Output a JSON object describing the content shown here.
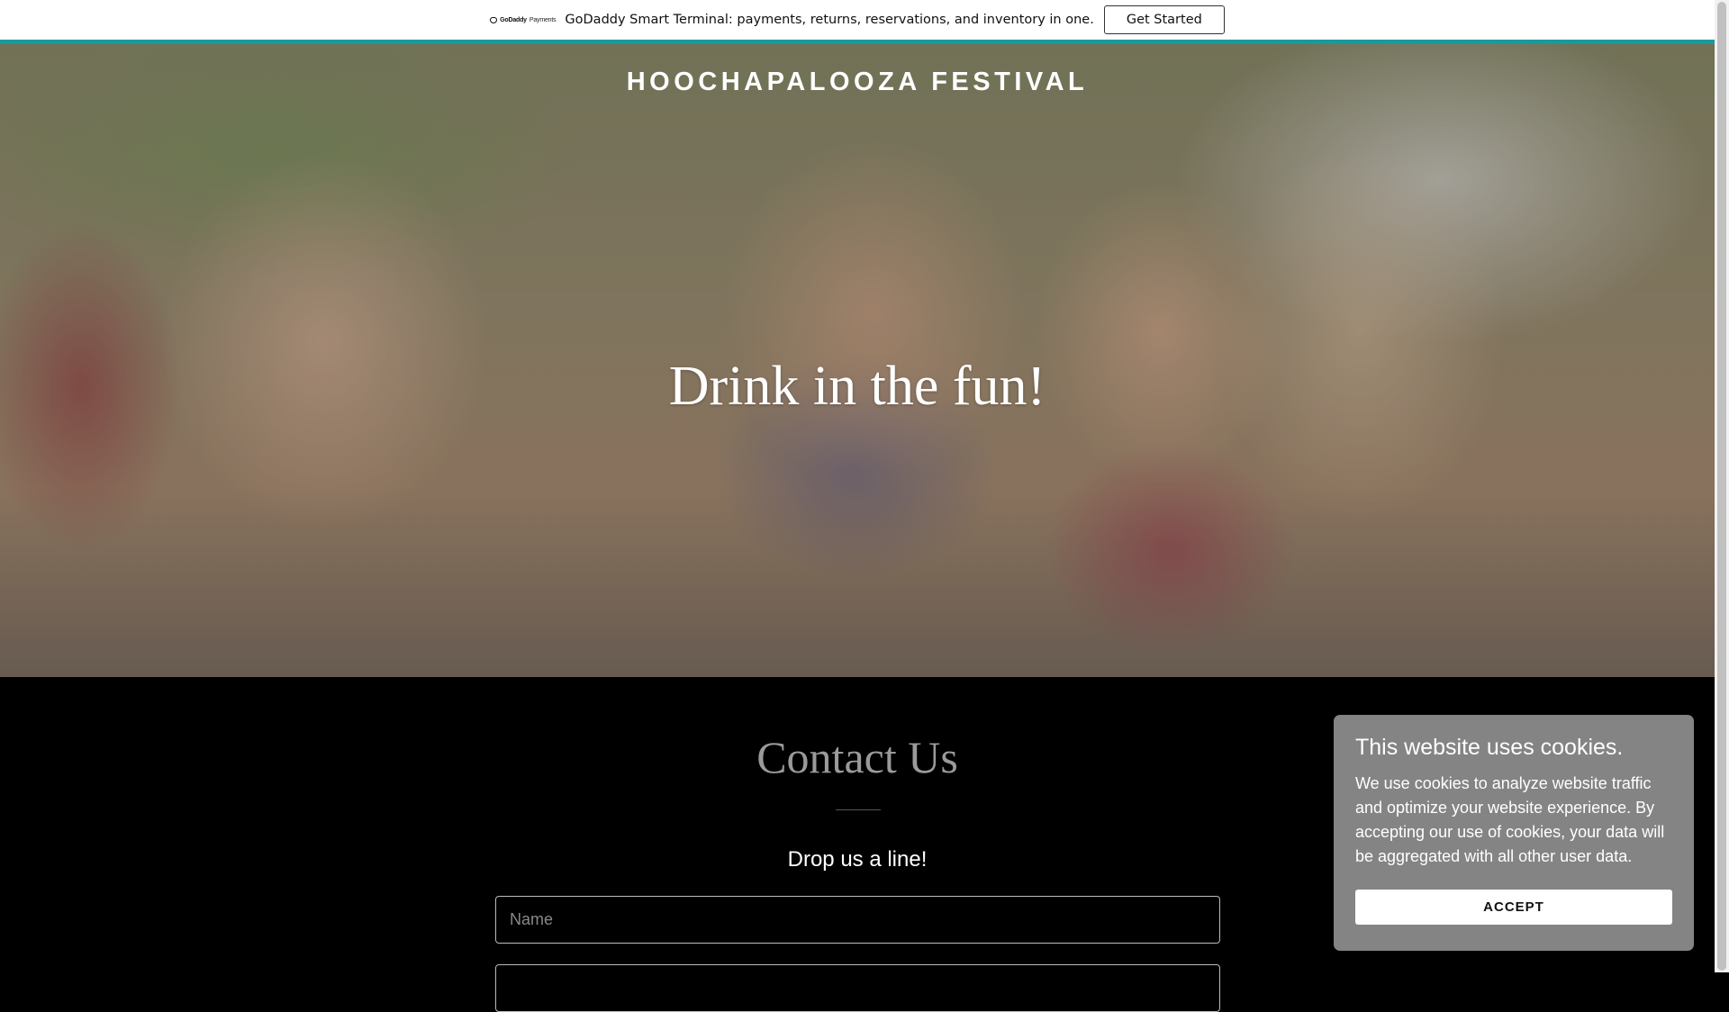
{
  "promo": {
    "logo_brand": "GoDaddy",
    "logo_suffix": "Payments",
    "text": "GoDaddy Smart Terminal: payments, returns, reservations, and inventory in one.",
    "button_label": "Get Started"
  },
  "hero": {
    "site_title": "HOOCHAPALOOZA FESTIVAL",
    "heading": "Drink in the fun!"
  },
  "contact": {
    "title": "Contact Us",
    "subtitle": "Drop us a line!",
    "name_placeholder": "Name"
  },
  "cookie": {
    "title": "This website uses cookies.",
    "body": "We use cookies to analyze website traffic and optimize your website experience. By accepting our use of cookies, your data will be aggregated with all other user data.",
    "button_label": "ACCEPT"
  },
  "colors": {
    "accent": "#1a9a9a",
    "background": "#000000",
    "cookie_panel": "#848484"
  }
}
